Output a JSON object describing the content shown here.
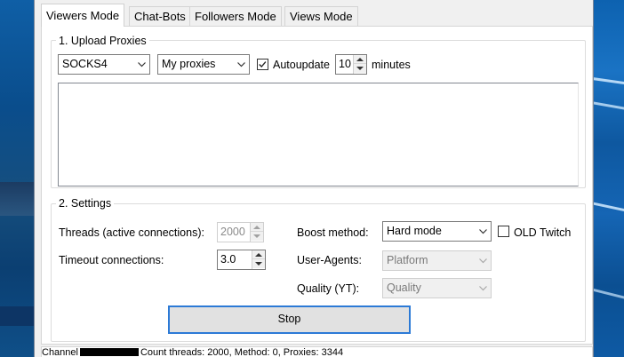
{
  "tabs": [
    {
      "label": "Viewers Mode",
      "active": true
    },
    {
      "label": "Chat-Bots",
      "active": false
    },
    {
      "label": "Followers Mode",
      "active": false
    },
    {
      "label": "Views Mode",
      "active": false
    }
  ],
  "upload": {
    "legend": "1. Upload Proxies",
    "proxy_type": "SOCKS4",
    "proxy_source": "My proxies",
    "autoupdate_label": "Autoupdate",
    "autoupdate_checked": true,
    "autoupdate_value": "10",
    "minutes_label": "minutes",
    "proxy_list_text": ""
  },
  "settings": {
    "legend": "2. Settings",
    "threads_label": "Threads (active connections):",
    "threads_value": "2000",
    "timeout_label": "Timeout connections:",
    "timeout_value": "3.0",
    "boost_label": "Boost method:",
    "boost_value": "Hard mode",
    "old_twitch_label": "OLD Twitch",
    "old_twitch_checked": false,
    "useragents_label": "User-Agents:",
    "useragents_value": "Platform",
    "quality_label": "Quality (YT):",
    "quality_value": "Quality"
  },
  "stop_label": "Stop",
  "status": {
    "channel_label": "Channel",
    "text": "Count threads: 2000, Method: 0, Proxies: 3344"
  },
  "colors": {
    "focus_border": "#2c7ad6",
    "desktop_blue": "#0a4d8c"
  }
}
